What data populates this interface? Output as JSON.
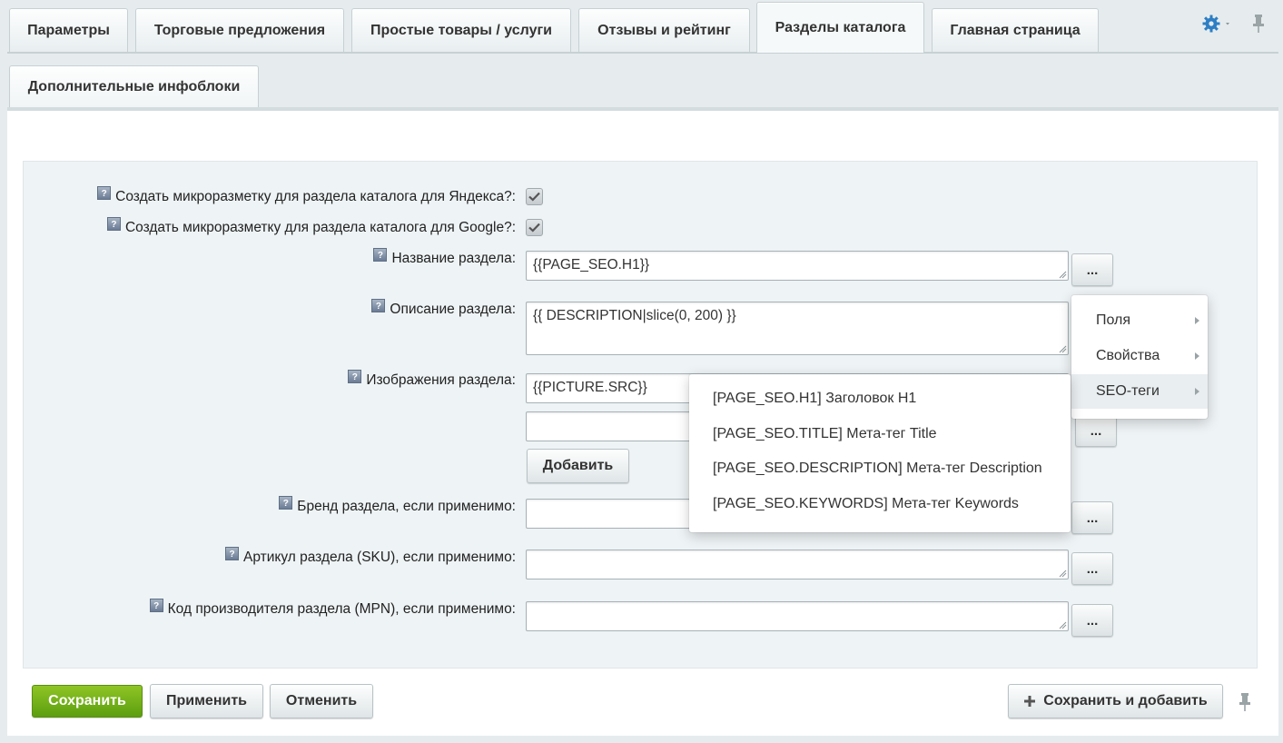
{
  "tabs": [
    {
      "label": "Параметры"
    },
    {
      "label": "Торговые предложения"
    },
    {
      "label": "Простые товары / услуги"
    },
    {
      "label": "Отзывы и рейтинг"
    },
    {
      "label": "Разделы каталога"
    },
    {
      "label": "Главная страница"
    }
  ],
  "subtab": {
    "label": "Дополнительные инфоблоки"
  },
  "fields": {
    "yandex_label": "Создать микроразметку для раздела каталога для Яндекса?:",
    "google_label": "Создать микроразметку для раздела каталога для Google?:",
    "name_label": "Название раздела:",
    "name_value": "{{PAGE_SEO.H1}}",
    "desc_label": "Описание раздела:",
    "desc_value": "{{ DESCRIPTION|slice(0, 200) }}",
    "images_label": "Изображения раздела:",
    "images_value": "{{PICTURE.SRC}}",
    "add_label": "Добавить",
    "brand_label": "Бренд раздела, если применимо:",
    "sku_label": "Артикул раздела (SKU), если применимо:",
    "mpn_label": "Код производителя раздела (MPN), если применимо:"
  },
  "help_glyph": "?",
  "dots_label": "...",
  "menu1": [
    {
      "label": "Поля"
    },
    {
      "label": "Свойства"
    },
    {
      "label": "SEO-теги"
    }
  ],
  "menu2": [
    {
      "label": "[PAGE_SEO.H1] Заголовок H1"
    },
    {
      "label": "[PAGE_SEO.TITLE] Мета-тег Title"
    },
    {
      "label": "[PAGE_SEO.DESCRIPTION] Мета-тег Description"
    },
    {
      "label": "[PAGE_SEO.KEYWORDS] Мета-тег Keywords"
    }
  ],
  "footer": {
    "save": "Сохранить",
    "apply": "Применить",
    "cancel": "Отменить",
    "save_add": "Сохранить и добавить"
  },
  "colors": {
    "accent": "#2d7ec4",
    "green": "#6fae17"
  }
}
